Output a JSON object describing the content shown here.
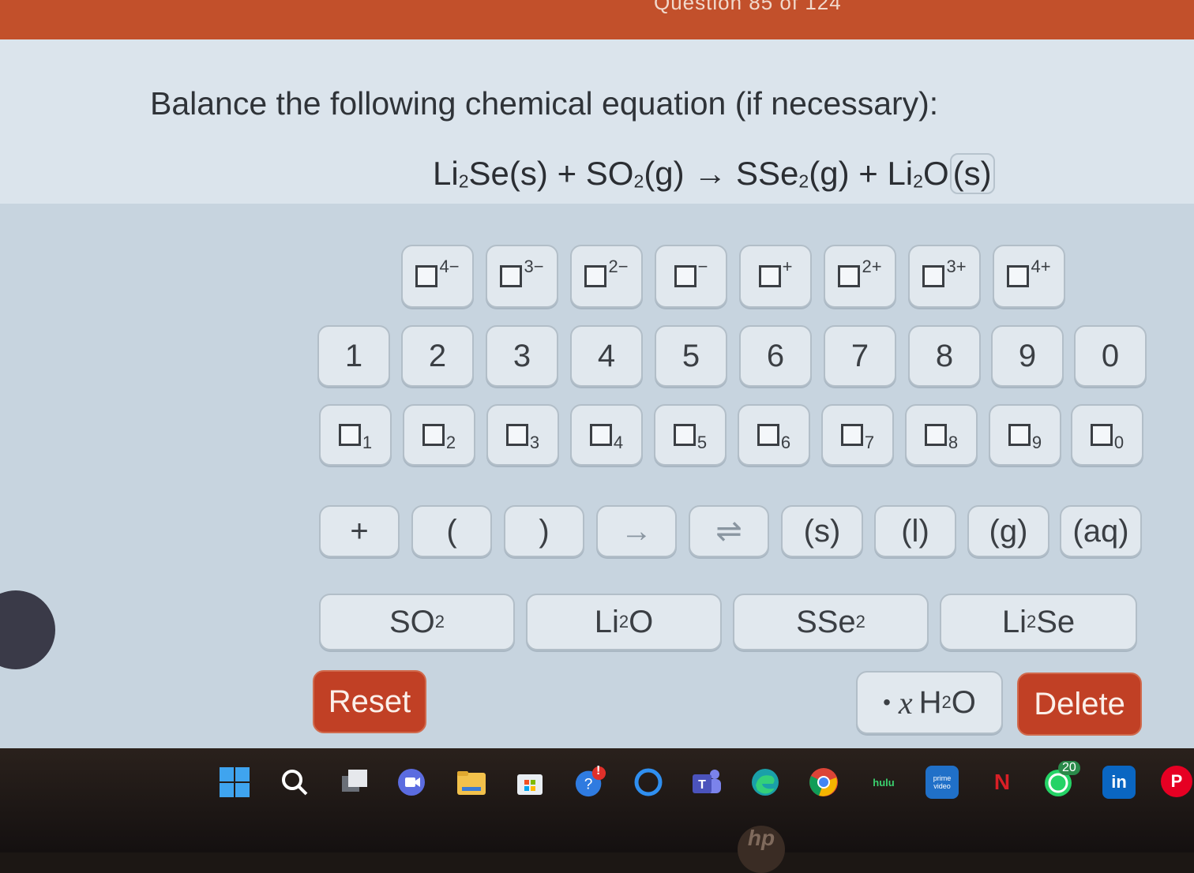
{
  "header": {
    "question_counter": "Question 85 of 124"
  },
  "prompt": {
    "text": "Balance the following chemical equation (if necessary):",
    "equation": {
      "r1": "Li",
      "r1_sub": "2",
      "r1_rest": "Se(s)",
      "plus1": " + ",
      "r2": "SO",
      "r2_sub": "2",
      "r2_rest": "(g)",
      "arrow": " → ",
      "p1": "SSe",
      "p1_sub": "2",
      "p1_rest": "(g)",
      "plus2": " + ",
      "p2": "Li",
      "p2_sub": "2",
      "p2_pre": "O",
      "p2_rest": "(s)"
    }
  },
  "charge_keys": [
    "4−",
    "3−",
    "2−",
    "−",
    "+",
    "2+",
    "3+",
    "4+"
  ],
  "digit_keys": [
    "1",
    "2",
    "3",
    "4",
    "5",
    "6",
    "7",
    "8",
    "9",
    "0"
  ],
  "subscript_keys": [
    "1",
    "2",
    "3",
    "4",
    "5",
    "6",
    "7",
    "8",
    "9",
    "0"
  ],
  "symbol_keys": [
    "+",
    "(",
    ")",
    "→",
    "⇌",
    "(s)",
    "(l)",
    "(g)",
    "(aq)"
  ],
  "species_keys": [
    {
      "main": "SO",
      "sub": "2",
      "rest": ""
    },
    {
      "main": "Li",
      "sub": "2",
      "rest": "O"
    },
    {
      "main": "SSe",
      "sub": "2",
      "rest": ""
    },
    {
      "main": "Li",
      "sub": "2",
      "rest": "Se"
    }
  ],
  "actions": {
    "reset": "Reset",
    "hydrate_dot": "•",
    "hydrate_x": "x",
    "hydrate_h": "H",
    "hydrate_sub": "2",
    "hydrate_o": "O",
    "delete": "Delete"
  },
  "taskbar": {
    "hulu": "hulu",
    "prime": "prime video",
    "netflix": "N",
    "whatsapp_badge": "20",
    "linkedin": "in",
    "pinterest": "P",
    "alert": "!",
    "hp_logo": "hp"
  },
  "colors": {
    "accent_red": "#c14025",
    "header_red": "#c2502b"
  }
}
